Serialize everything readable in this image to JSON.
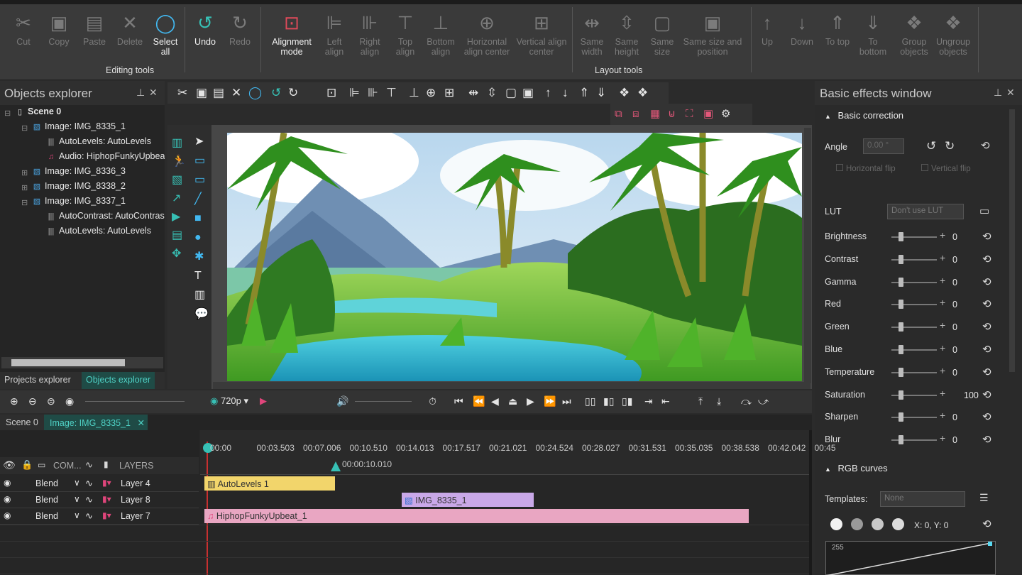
{
  "ribbon": {
    "groups": {
      "editing": "Editing tools",
      "layout": "Layout tools"
    },
    "buttons": [
      {
        "id": "cut",
        "label": "Cut",
        "icon": "scissors-icon",
        "glyph": "✂",
        "enabled": false
      },
      {
        "id": "copy",
        "label": "Copy",
        "icon": "copy-icon",
        "glyph": "▣",
        "enabled": false
      },
      {
        "id": "paste",
        "label": "Paste",
        "icon": "paste-icon",
        "glyph": "▤",
        "enabled": false
      },
      {
        "id": "delete",
        "label": "Delete",
        "icon": "delete-icon",
        "glyph": "✕",
        "enabled": false
      },
      {
        "id": "select_all",
        "label": "Select all",
        "icon": "select-all-icon",
        "glyph": "◯",
        "enabled": true
      },
      {
        "id": "undo",
        "label": "Undo",
        "icon": "undo-icon",
        "glyph": "↺",
        "enabled": true
      },
      {
        "id": "redo",
        "label": "Redo",
        "icon": "redo-icon",
        "glyph": "↻",
        "enabled": false
      },
      {
        "id": "alignment_mode",
        "label": "Alignment mode",
        "icon": "alignment-mode-icon",
        "glyph": "⊡",
        "enabled": true
      },
      {
        "id": "left_align",
        "label": "Left align",
        "icon": "left-align-icon",
        "glyph": "⊫",
        "enabled": false
      },
      {
        "id": "right_align",
        "label": "Right align",
        "icon": "right-align-icon",
        "glyph": "⊪",
        "enabled": false
      },
      {
        "id": "top_align",
        "label": "Top align",
        "icon": "top-align-icon",
        "glyph": "⊤",
        "enabled": false
      },
      {
        "id": "bottom_align",
        "label": "Bottom align",
        "icon": "bottom-align-icon",
        "glyph": "⊥",
        "enabled": false
      },
      {
        "id": "h_center",
        "label": "Horizontal align center",
        "icon": "horizontal-center-icon",
        "glyph": "⊕",
        "enabled": false
      },
      {
        "id": "v_center",
        "label": "Vertical align center",
        "icon": "vertical-center-icon",
        "glyph": "⊞",
        "enabled": false
      },
      {
        "id": "same_width",
        "label": "Same width",
        "icon": "same-width-icon",
        "glyph": "⇹",
        "enabled": false
      },
      {
        "id": "same_height",
        "label": "Same height",
        "icon": "same-height-icon",
        "glyph": "⇳",
        "enabled": false
      },
      {
        "id": "same_size",
        "label": "Same size",
        "icon": "same-size-icon",
        "glyph": "▢",
        "enabled": false
      },
      {
        "id": "same_size_pos",
        "label": "Same size and position",
        "icon": "same-size-position-icon",
        "glyph": "▣",
        "enabled": false
      },
      {
        "id": "up",
        "label": "Up",
        "icon": "arrow-up-icon",
        "glyph": "↑",
        "enabled": false
      },
      {
        "id": "down",
        "label": "Down",
        "icon": "arrow-down-icon",
        "glyph": "↓",
        "enabled": false
      },
      {
        "id": "to_top",
        "label": "To top",
        "icon": "to-top-icon",
        "glyph": "⇑",
        "enabled": false
      },
      {
        "id": "to_bottom",
        "label": "To bottom",
        "icon": "to-bottom-icon",
        "glyph": "⇓",
        "enabled": false
      },
      {
        "id": "group",
        "label": "Group objects",
        "icon": "group-objects-icon",
        "glyph": "❖",
        "enabled": false
      },
      {
        "id": "ungroup",
        "label": "Ungroup objects",
        "icon": "ungroup-objects-icon",
        "glyph": "❖",
        "enabled": false
      }
    ]
  },
  "objects_explorer": {
    "title": "Objects explorer",
    "items": [
      {
        "label": "Scene 0",
        "icon": "scene-icon",
        "glyph": "▯",
        "kind": "scene"
      },
      {
        "label": "Image: IMG_8335_1",
        "icon": "image-icon",
        "glyph": "▧",
        "kind": "img"
      },
      {
        "label": "AutoLevels: AutoLevels",
        "icon": "effect-icon",
        "glyph": "|||",
        "kind": "fx"
      },
      {
        "label": "Audio: HiphopFunkyUpbeat",
        "icon": "audio-icon",
        "glyph": "♫",
        "kind": "aud"
      },
      {
        "label": "Image: IMG_8336_3",
        "icon": "image-icon",
        "glyph": "▧",
        "kind": "img"
      },
      {
        "label": "Image: IMG_8338_2",
        "icon": "image-icon",
        "glyph": "▧",
        "kind": "img"
      },
      {
        "label": "Image: IMG_8337_1",
        "icon": "image-icon",
        "glyph": "▧",
        "kind": "img"
      },
      {
        "label": "AutoContrast: AutoContrast",
        "icon": "effect-icon",
        "glyph": "|||",
        "kind": "fx"
      },
      {
        "label": "AutoLevels: AutoLevels",
        "icon": "effect-icon",
        "glyph": "|||",
        "kind": "fx"
      }
    ],
    "tabs": [
      "Projects explorer",
      "Objects explorer"
    ]
  },
  "effects": {
    "title": "Basic effects window",
    "basic_correction": "Basic correction",
    "angle_label": "Angle",
    "angle_value": "0.00 °",
    "horizontal_flip": "Horizontal flip",
    "vertical_flip": "Vertical flip",
    "lut_label": "LUT",
    "lut_value": "Don't use LUT",
    "params": [
      {
        "label": "Brightness",
        "value": "0",
        "level": 0
      },
      {
        "label": "Contrast",
        "value": "0",
        "level": 0
      },
      {
        "label": "Gamma",
        "value": "0",
        "level": 0
      },
      {
        "label": "Red",
        "value": "0",
        "level": 0
      },
      {
        "label": "Green",
        "value": "0",
        "level": 0
      },
      {
        "label": "Blue",
        "value": "0",
        "level": 0
      },
      {
        "label": "Temperature",
        "value": "0",
        "level": 0
      },
      {
        "label": "Saturation",
        "value": "100",
        "level": 0
      },
      {
        "label": "Sharpen",
        "value": "0",
        "level": 0
      },
      {
        "label": "Blur",
        "value": "0",
        "level": 0
      }
    ],
    "rgb_curves": "RGB curves",
    "templates_label": "Templates:",
    "templates_value": "None",
    "xy_readout": "X: 0, Y: 0",
    "curve_max": "255"
  },
  "timeline": {
    "resolution": "720p",
    "tabs": [
      "Scene 0",
      "Image: IMG_8335_1"
    ],
    "ticks": [
      "00:00",
      "00:03.503",
      "00:07.006",
      "00:10.510",
      "00:14.013",
      "00:17.517",
      "00:21.021",
      "00:24.524",
      "00:28.027",
      "00:31.531",
      "00:35.035",
      "00:38.538",
      "00:42.042",
      "00:45"
    ],
    "playhead": "00:00:10.010",
    "header": {
      "composition": "COM...",
      "layers": "LAYERS"
    },
    "layers": [
      {
        "blend": "Blend",
        "name": "Layer 4",
        "clip": "AutoLevels 1",
        "clip_color": "#f2d56b",
        "clip_icon": "effect-icon"
      },
      {
        "blend": "Blend",
        "name": "Layer 8",
        "clip": "IMG_8335_1",
        "clip_color": "#c9a8e8",
        "clip_icon": "image-icon"
      },
      {
        "blend": "Blend",
        "name": "Layer 7",
        "clip": "HiphopFunkyUpbeat_1",
        "clip_color": "#e9a6c2",
        "clip_icon": "audio-icon"
      }
    ]
  },
  "colors": {
    "accent": "#37c0b5",
    "select": "#42b8f0"
  }
}
